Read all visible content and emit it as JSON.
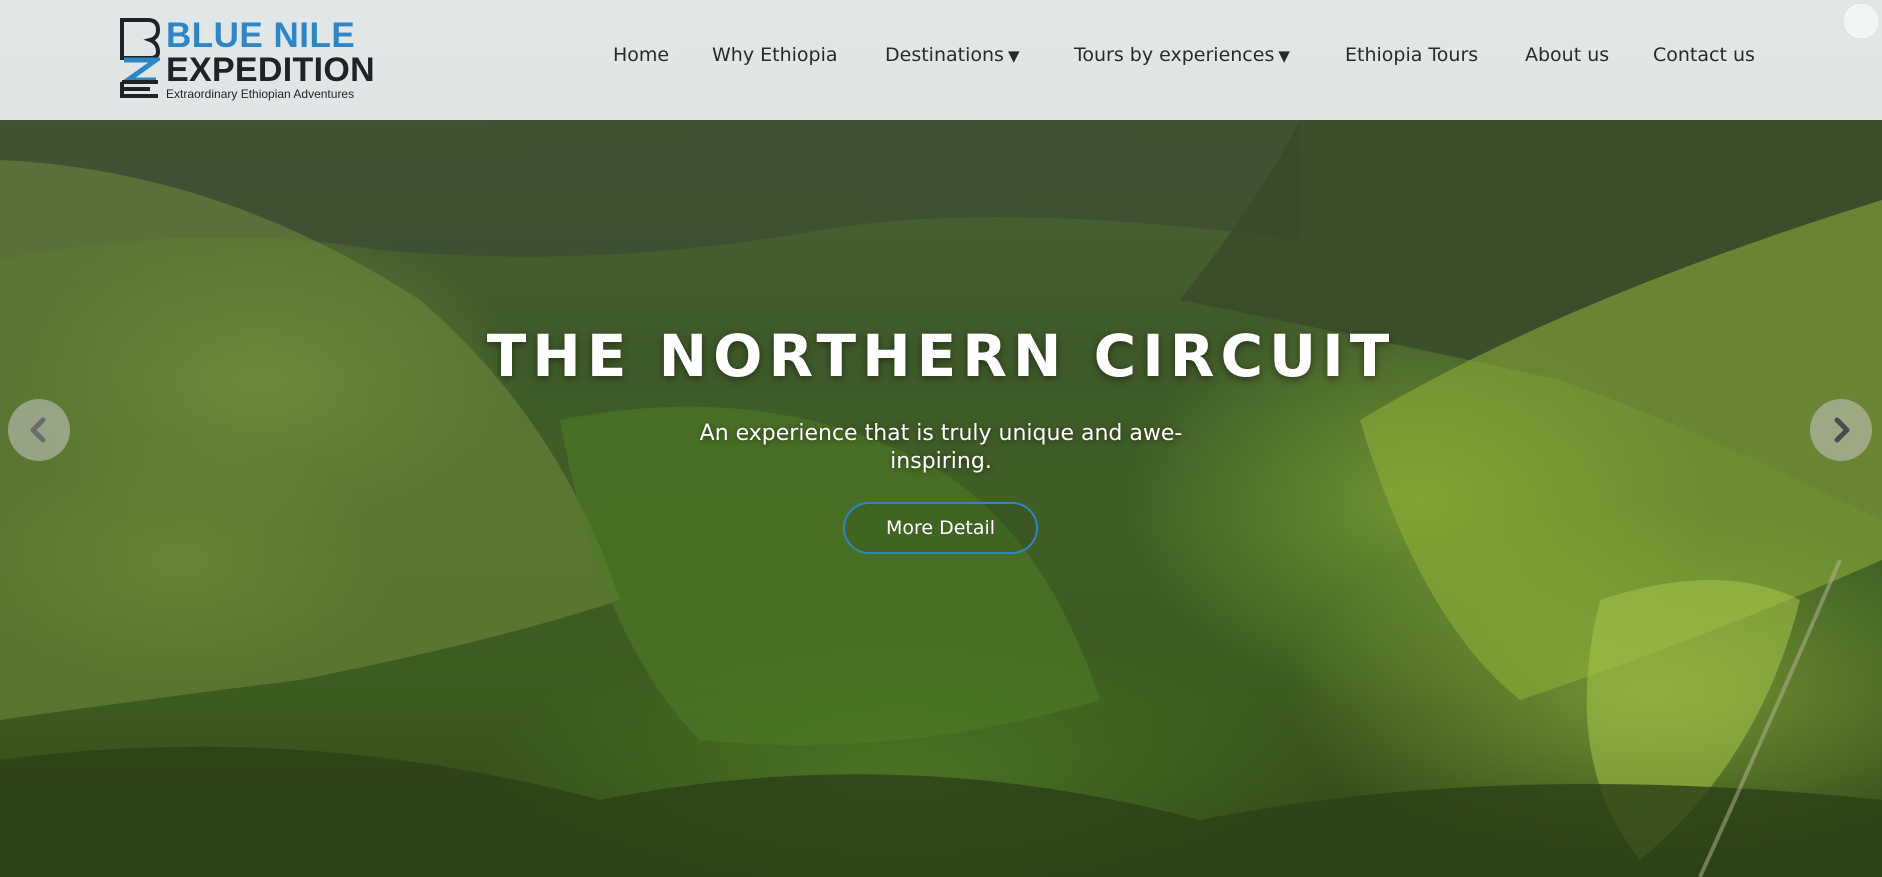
{
  "brand": {
    "line1": "BLUE NILE",
    "line2": "EXPEDITION",
    "tagline": "Extraordinary Ethiopian Adventures",
    "logo_icon": "bne-monogram-icon",
    "accent_color": "#2f86c4",
    "dark_color": "#1f2326"
  },
  "nav": {
    "items": [
      {
        "label": "Home"
      },
      {
        "label": "Why Ethiopia"
      },
      {
        "label": "Destinations",
        "caret": "▼"
      },
      {
        "label": "Tours by experiences",
        "caret": "▼"
      },
      {
        "label": "Ethiopia Tours"
      },
      {
        "label": "About us"
      },
      {
        "label": "Contact us"
      }
    ]
  },
  "slide": {
    "title": "THE NORTHERN CIRCUIT",
    "subtitle": "An experience that is truly unique and awe-inspiring.",
    "button_label": "More Detail",
    "background": "green terraced mountain valley"
  },
  "carousel": {
    "prev_icon": "chevron-left-icon",
    "next_icon": "chevron-right-icon"
  }
}
